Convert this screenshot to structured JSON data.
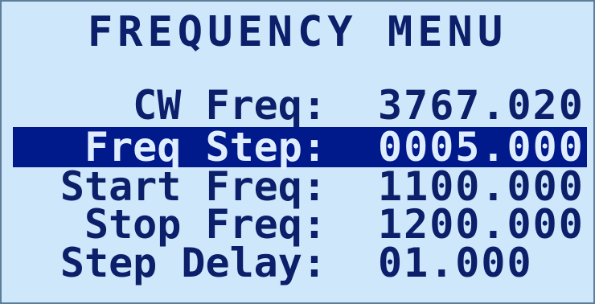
{
  "screen": {
    "title": "FREQUENCY MENU",
    "colors": {
      "background": "#cfe7fb",
      "text": "#0b1f6a",
      "highlight_bg": "#001a8c",
      "highlight_text": "#dfeeff"
    },
    "rows": [
      {
        "label": "CW Freq:",
        "value": "3767.020",
        "selected": false
      },
      {
        "label": "Freq Step:",
        "value": "0005.000",
        "selected": true
      },
      {
        "label": "Start Freq:",
        "value": "1100.000",
        "selected": false
      },
      {
        "label": "Stop Freq:",
        "value": "1200.000",
        "selected": false
      },
      {
        "label": "Step Delay:",
        "value": "01.000",
        "selected": false
      }
    ]
  }
}
